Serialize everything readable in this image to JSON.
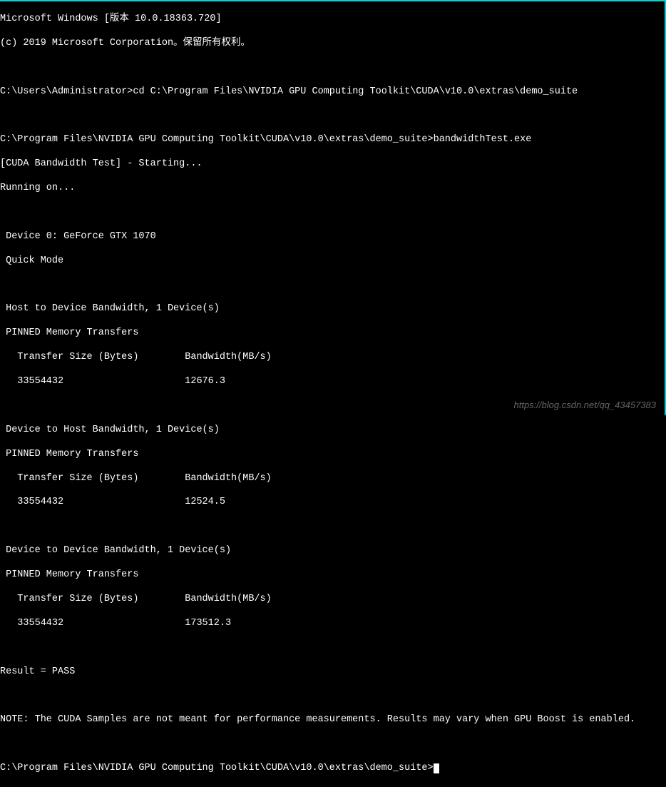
{
  "header": {
    "line1": "Microsoft Windows [版本 10.0.18363.720]",
    "line2": "(c) 2019 Microsoft Corporation。保留所有权利。"
  },
  "commands": {
    "prompt1": "C:\\Users\\Administrator>",
    "cmd1": "cd C:\\Program Files\\NVIDIA GPU Computing Toolkit\\CUDA\\v10.0\\extras\\demo_suite",
    "prompt2": "C:\\Program Files\\NVIDIA GPU Computing Toolkit\\CUDA\\v10.0\\extras\\demo_suite>",
    "cmd2": "bandwidthTest.exe",
    "prompt3": "C:\\Program Files\\NVIDIA GPU Computing Toolkit\\CUDA\\v10.0\\extras\\demo_suite>"
  },
  "output": {
    "starting": "[CUDA Bandwidth Test] - Starting...",
    "running": "Running on...",
    "device": " Device 0: GeForce GTX 1070",
    "mode": " Quick Mode",
    "h2d_header": " Host to Device Bandwidth, 1 Device(s)",
    "h2d_mem": " PINNED Memory Transfers",
    "h2d_cols": "   Transfer Size (Bytes)        Bandwidth(MB/s)",
    "h2d_data": "   33554432                     12676.3",
    "d2h_header": " Device to Host Bandwidth, 1 Device(s)",
    "d2h_mem": " PINNED Memory Transfers",
    "d2h_cols": "   Transfer Size (Bytes)        Bandwidth(MB/s)",
    "d2h_data": "   33554432                     12524.5",
    "d2d_header": " Device to Device Bandwidth, 1 Device(s)",
    "d2d_mem": " PINNED Memory Transfers",
    "d2d_cols": "   Transfer Size (Bytes)        Bandwidth(MB/s)",
    "d2d_data": "   33554432                     173512.3",
    "result": "Result = PASS",
    "note": "NOTE: The CUDA Samples are not meant for performance measurements. Results may vary when GPU Boost is enabled."
  },
  "watermark": "https://blog.csdn.net/qq_43457383"
}
